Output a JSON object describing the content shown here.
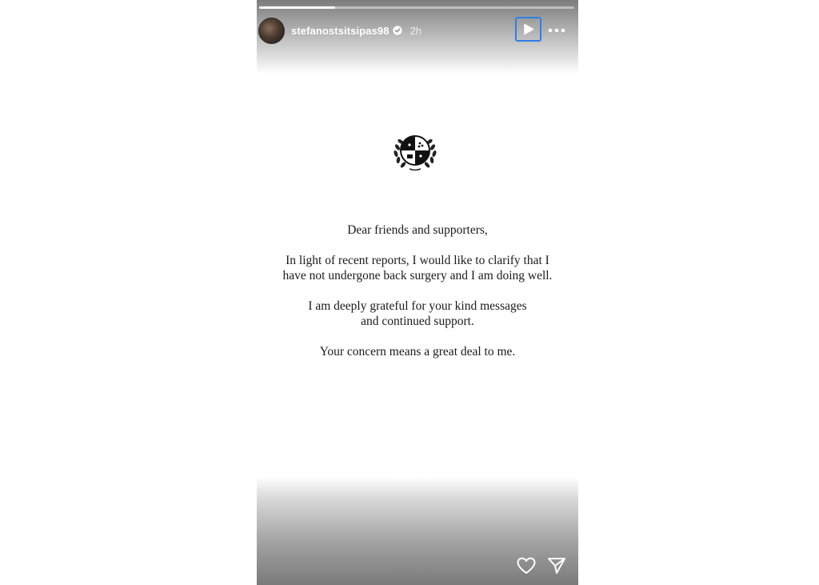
{
  "story": {
    "progress": 0.24,
    "username": "stefanostsitsipas98",
    "verified": true,
    "time_ago": "2h",
    "icons": {
      "play": "play-icon",
      "more": "more-options-icon",
      "verified": "verified-badge-icon",
      "like": "heart-icon",
      "share": "send-icon"
    },
    "accent_color": "#2f7fe6"
  },
  "letter": {
    "greeting": "Dear friends and supporters,",
    "para1_line1": "In light of recent reports, I would like to clarify that I",
    "para1_line2": "have not undergone back surgery and I am doing well.",
    "para2_line1": "I am deeply grateful for your kind messages",
    "para2_line2": "and continued support.",
    "closing": "Your concern means a great deal to me."
  }
}
